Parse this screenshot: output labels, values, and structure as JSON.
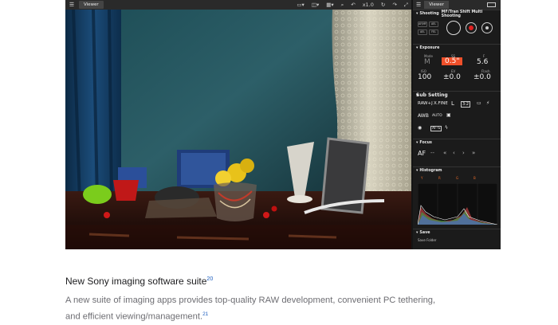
{
  "viewer": {
    "menu_icon": "hamburger-icon",
    "tab_label": "Viewer",
    "toolbar_value": "x1.0",
    "colors": {
      "bar": "#2a2a2a",
      "panel": "#1b1b1b",
      "accent": "#f0502a",
      "red": "#e02020"
    }
  },
  "remote": {
    "tab_label": "Viewer",
    "shooting": {
      "title": "Shooting",
      "subtitle": "MF/Tran Shift Multi Shooting",
      "buttons": [
        "AF/MF",
        "AEL",
        "AEL",
        "FEL"
      ]
    },
    "exposure": {
      "title": "Exposure",
      "mode_label": "Mode",
      "mode_value": "M",
      "ss_label": "SS",
      "ss_value": "0.5\"",
      "f_label": "F",
      "f_value": "5.6",
      "iso_label": "ISO",
      "iso_value": "100",
      "ev_label": "EV",
      "ev_value": "±0.0",
      "flash_label": "Flash",
      "flash_value": "±0.0"
    },
    "setting": {
      "title": "Sub Setting",
      "row1": [
        "RAW+J",
        "X.FINE",
        "L",
        "3:2"
      ],
      "row2": [
        "AWB",
        "AUTO"
      ],
      "row3": [
        "AF-S"
      ]
    },
    "focus": {
      "title": "Focus",
      "af_label": "AF",
      "af_value": "--"
    },
    "histogram": {
      "title": "Histogram",
      "channels": [
        "Y",
        "R",
        "G",
        "B"
      ]
    },
    "save": {
      "title": "Save",
      "folder_label": "Save Folder"
    }
  },
  "caption": {
    "title": "New Sony imaging software suite",
    "title_ref": "20",
    "description": "A new suite of imaging apps provides top-quality RAW development, convenient PC tethering, and efficient viewing/management.",
    "description_ref": "21"
  }
}
